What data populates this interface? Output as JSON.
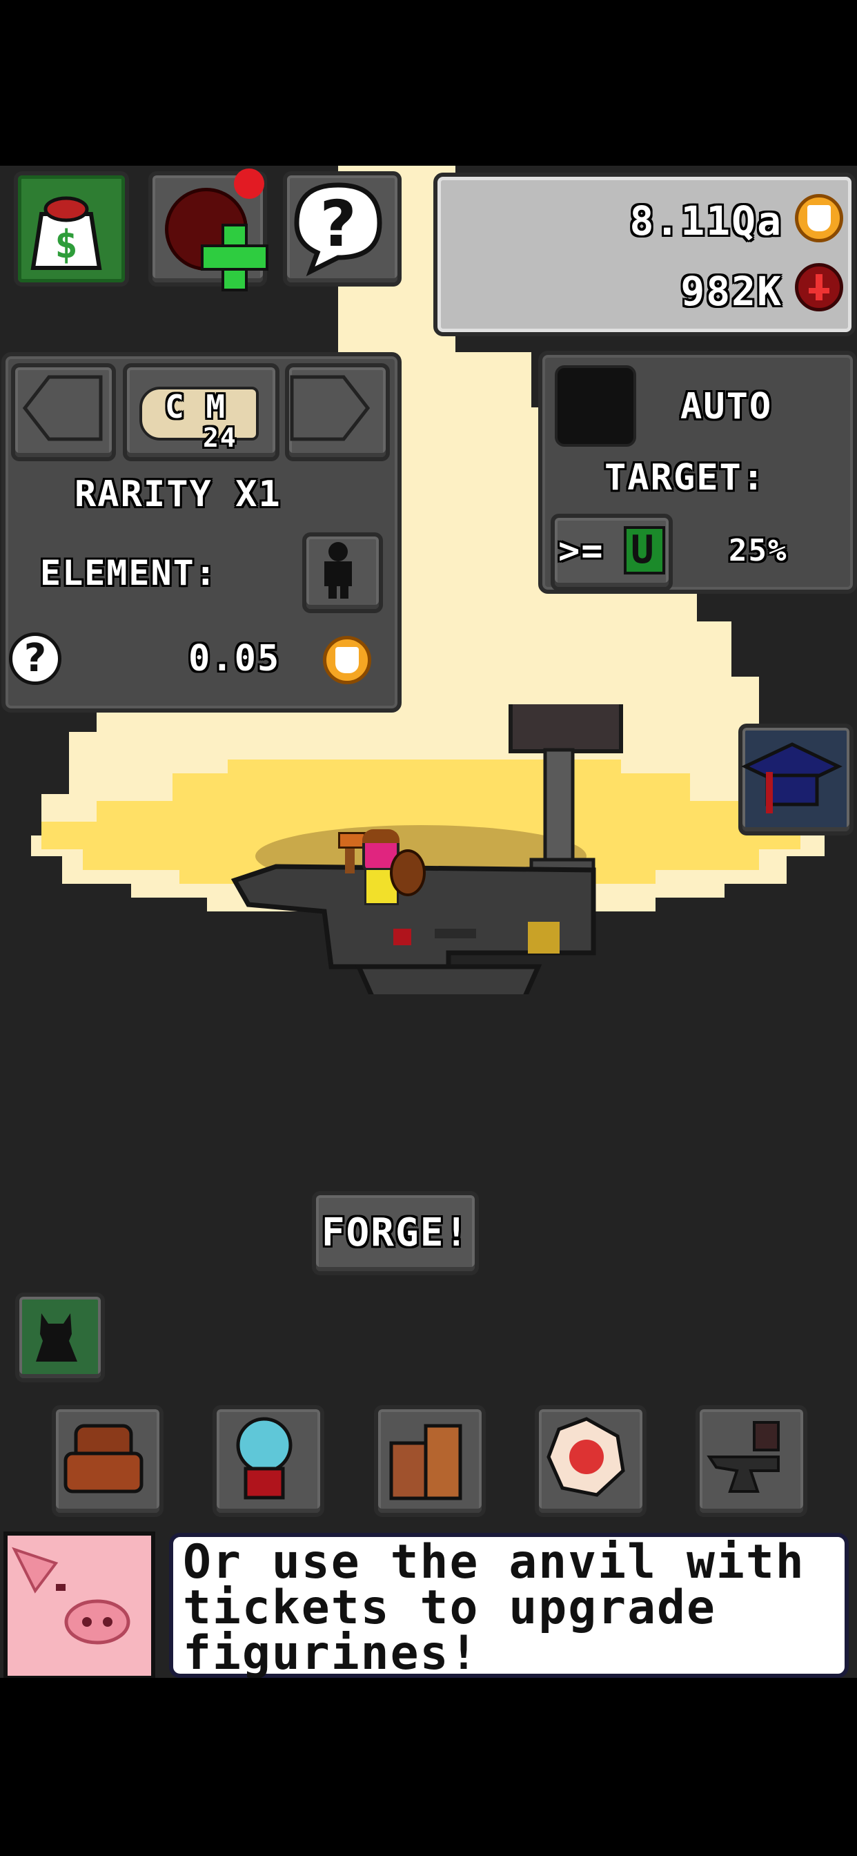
{
  "currency": {
    "gold_amount": "8.11Qa",
    "gold_icon": "gold-coin-icon",
    "ruby_amount": "982K",
    "ruby_icon": "ruby-coin-icon"
  },
  "top_buttons": [
    {
      "name": "shop-button",
      "icon": "money-bag-icon",
      "bg": "#2e7d32"
    },
    {
      "name": "add-currency-button",
      "icon": "plus-icon",
      "bg": "#5a1a1a",
      "notification": true
    },
    {
      "name": "help-button",
      "icon": "question-speech-icon",
      "bg": "#4a4a4a"
    }
  ],
  "forge_settings": {
    "badge_letters": "C M",
    "ticket_count": "24",
    "rarity_label": "RARITY X1",
    "element_label": "ELEMENT:",
    "cost": "0.05"
  },
  "auto_panel": {
    "auto_label": "AUTO",
    "target_label": "TARGET:",
    "target_operator": ">=",
    "target_rarity": "U",
    "target_percent": "25%"
  },
  "forge_button": "FORGE!",
  "bottom_menu": [
    {
      "name": "armchair-button",
      "icon": "armchair-icon"
    },
    {
      "name": "gumball-machine-button",
      "icon": "gumball-machine-icon"
    },
    {
      "name": "boxes-button",
      "icon": "boxes-icon"
    },
    {
      "name": "sticker-button",
      "icon": "sticker-icon"
    },
    {
      "name": "anvil-button",
      "icon": "anvil-icon"
    }
  ],
  "dialog": {
    "speaker_icon": "pig-icon",
    "text": "Or use the anvil with tickets to upgrade figurines!"
  },
  "colors": {
    "background": "#232323",
    "light_beam": "#fdf0c4",
    "light_pool": "#ffe066",
    "panel": "#4a4a4a",
    "gold": "#f5a623",
    "ruby": "#8b0f12",
    "academy_button": "#1a2e4a"
  }
}
